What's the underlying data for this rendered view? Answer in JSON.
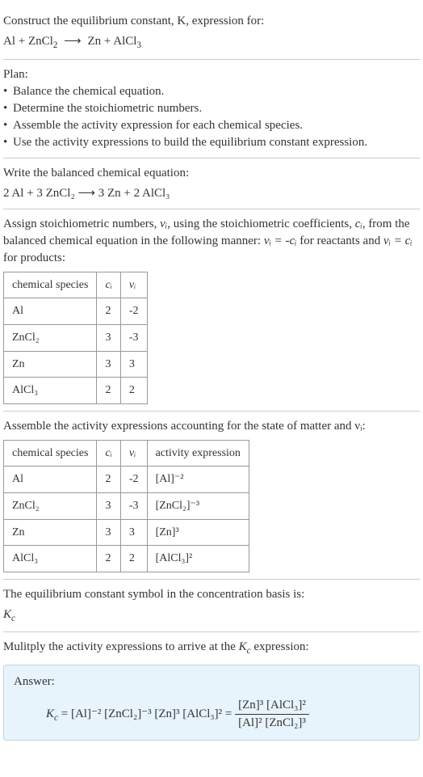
{
  "section1": {
    "line1": "Construct the equilibrium constant, K, expression for:",
    "eq_lhs": "Al + ZnCl",
    "eq_sub1": "2",
    "eq_rhs": "Zn + AlCl",
    "eq_sub2": "3"
  },
  "section2": {
    "header": "Plan:",
    "bullets": [
      "Balance the chemical equation.",
      "Determine the stoichiometric numbers.",
      "Assemble the activity expression for each chemical species.",
      "Use the activity expressions to build the equilibrium constant expression."
    ]
  },
  "section3": {
    "line1": "Write the balanced chemical equation:",
    "eq": "2 Al + 3 ZnCl₂  ⟶  3 Zn + 2 AlCl₃"
  },
  "section4": {
    "text_part1": "Assign stoichiometric numbers, ",
    "nu_i": "νᵢ",
    "text_part2": ", using the stoichiometric coefficients, ",
    "c_i": "cᵢ",
    "text_part3": ", from the balanced chemical equation in the following manner: ",
    "rel1": "νᵢ = -cᵢ",
    "text_part4": " for reactants and ",
    "rel2": "νᵢ = cᵢ",
    "text_part5": " for products:",
    "table": {
      "headers": [
        "chemical species",
        "cᵢ",
        "νᵢ"
      ],
      "rows": [
        [
          "Al",
          "2",
          "-2"
        ],
        [
          "ZnCl₂",
          "3",
          "-3"
        ],
        [
          "Zn",
          "3",
          "3"
        ],
        [
          "AlCl₃",
          "2",
          "2"
        ]
      ]
    }
  },
  "section5": {
    "line1": "Assemble the activity expressions accounting for the state of matter and νᵢ:",
    "table": {
      "headers": [
        "chemical species",
        "cᵢ",
        "νᵢ",
        "activity expression"
      ],
      "rows": [
        [
          "Al",
          "2",
          "-2",
          "[Al]⁻²"
        ],
        [
          "ZnCl₂",
          "3",
          "-3",
          "[ZnCl₂]⁻³"
        ],
        [
          "Zn",
          "3",
          "3",
          "[Zn]³"
        ],
        [
          "AlCl₃",
          "2",
          "2",
          "[AlCl₃]²"
        ]
      ]
    }
  },
  "section6": {
    "line1": "The equilibrium constant symbol in the concentration basis is:",
    "symbol": "K",
    "symbol_sub": "c"
  },
  "section7": {
    "line1": "Mulitply the activity expressions to arrive at the ",
    "kc": "K",
    "kc_sub": "c",
    "line1_end": " expression:",
    "answer": {
      "label": "Answer:",
      "lhs": "K",
      "lhs_sub": "c",
      "eq": " = [Al]⁻² [ZnCl₂]⁻³ [Zn]³ [AlCl₃]² = ",
      "frac_num": "[Zn]³ [AlCl₃]²",
      "frac_den": "[Al]² [ZnCl₂]³"
    }
  }
}
